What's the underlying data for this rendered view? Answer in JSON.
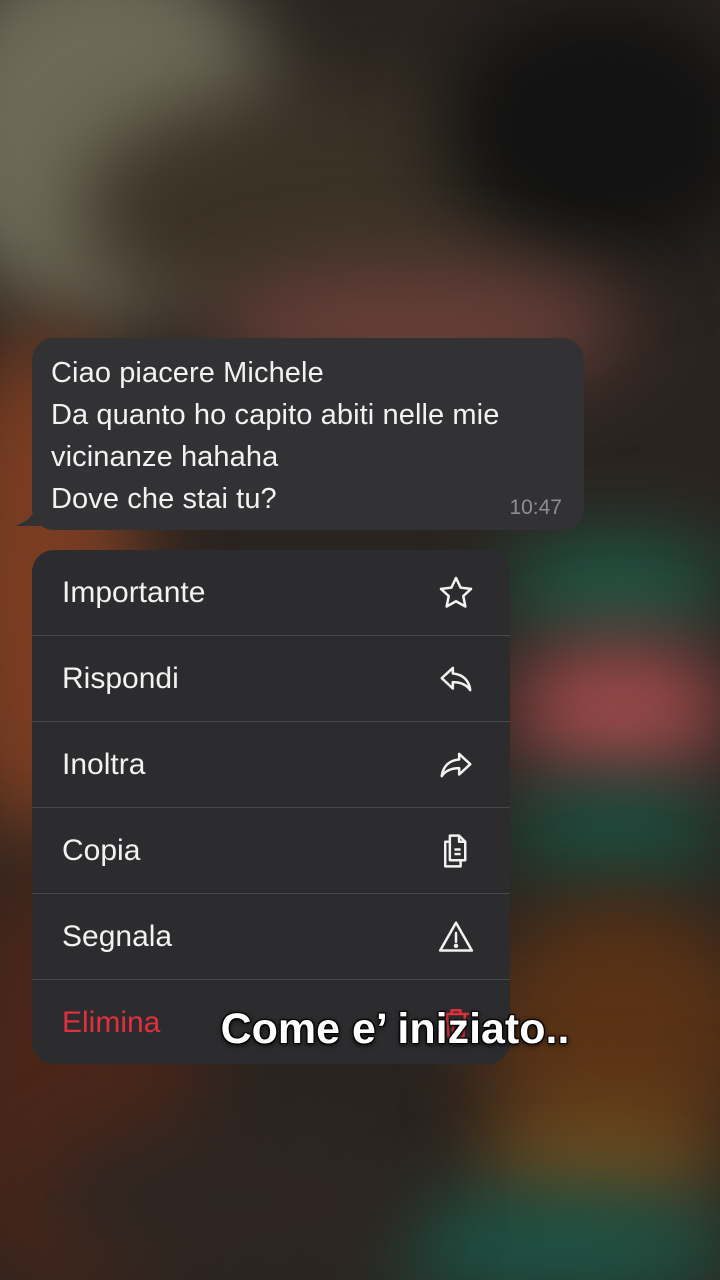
{
  "message": {
    "lines": [
      "Ciao piacere Michele",
      "Da quanto ho capito abiti nelle mie",
      "vicinanze hahaha",
      "Dove che stai tu?"
    ],
    "time": "10:47"
  },
  "menu": {
    "items": [
      {
        "label": "Importante",
        "icon": "star-icon"
      },
      {
        "label": "Rispondi",
        "icon": "reply-icon"
      },
      {
        "label": "Inoltra",
        "icon": "forward-icon"
      },
      {
        "label": "Copia",
        "icon": "copy-icon"
      },
      {
        "label": "Segnala",
        "icon": "warning-icon"
      },
      {
        "label": "Elimina",
        "icon": "trash-icon"
      }
    ]
  },
  "caption": "Come e’ iniziato..",
  "colors": {
    "danger": "#e0303e",
    "menu_bg": "#2c2c2e",
    "bubble_bg": "#323235"
  }
}
